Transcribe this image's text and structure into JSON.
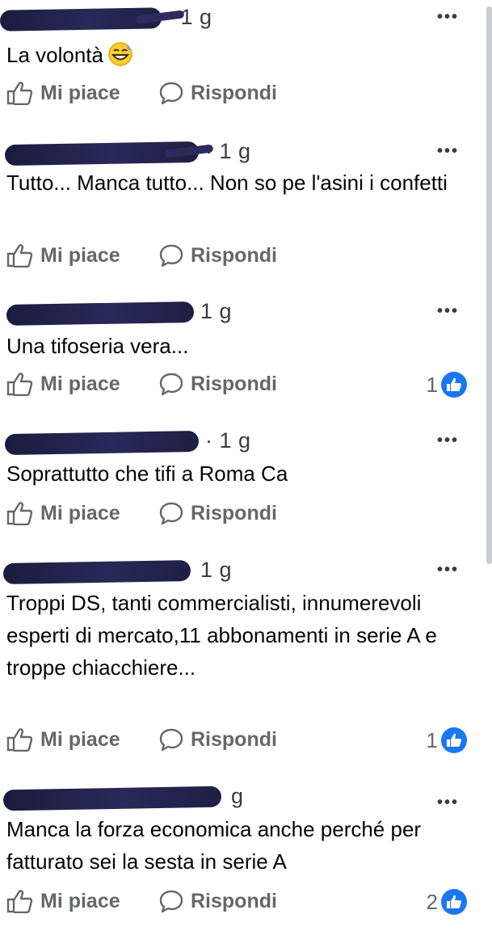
{
  "actions": {
    "like_label": "Mi piace",
    "reply_label": "Rispondi"
  },
  "comments": [
    {
      "time": "· 1 g",
      "text": "La volontà",
      "emoji": "grinning-sweat-emoji",
      "likes": null
    },
    {
      "time": "· 1 g",
      "text": "Tutto... Manca tutto... Non so pe l'asini i confetti",
      "likes": null
    },
    {
      "time": "1 g",
      "text": "Una tifoseria vera...",
      "likes": "1"
    },
    {
      "time": "· 1 g",
      "text": "Soprattutto che tifi a Roma Ca",
      "likes": null
    },
    {
      "time": "1 g",
      "text": "Troppi DS, tanti commercialisti, innumerevoli esperti di mercato,11 abbonamenti in serie A e troppe chiacchiere...",
      "likes": "1"
    },
    {
      "time": "g",
      "text": "Manca la forza economica anche perché per fatturato sei la sesta in serie A",
      "likes": "2"
    }
  ],
  "colors": {
    "accent": "#1877f2",
    "muted": "#65676b",
    "redaction": "#23264f"
  }
}
